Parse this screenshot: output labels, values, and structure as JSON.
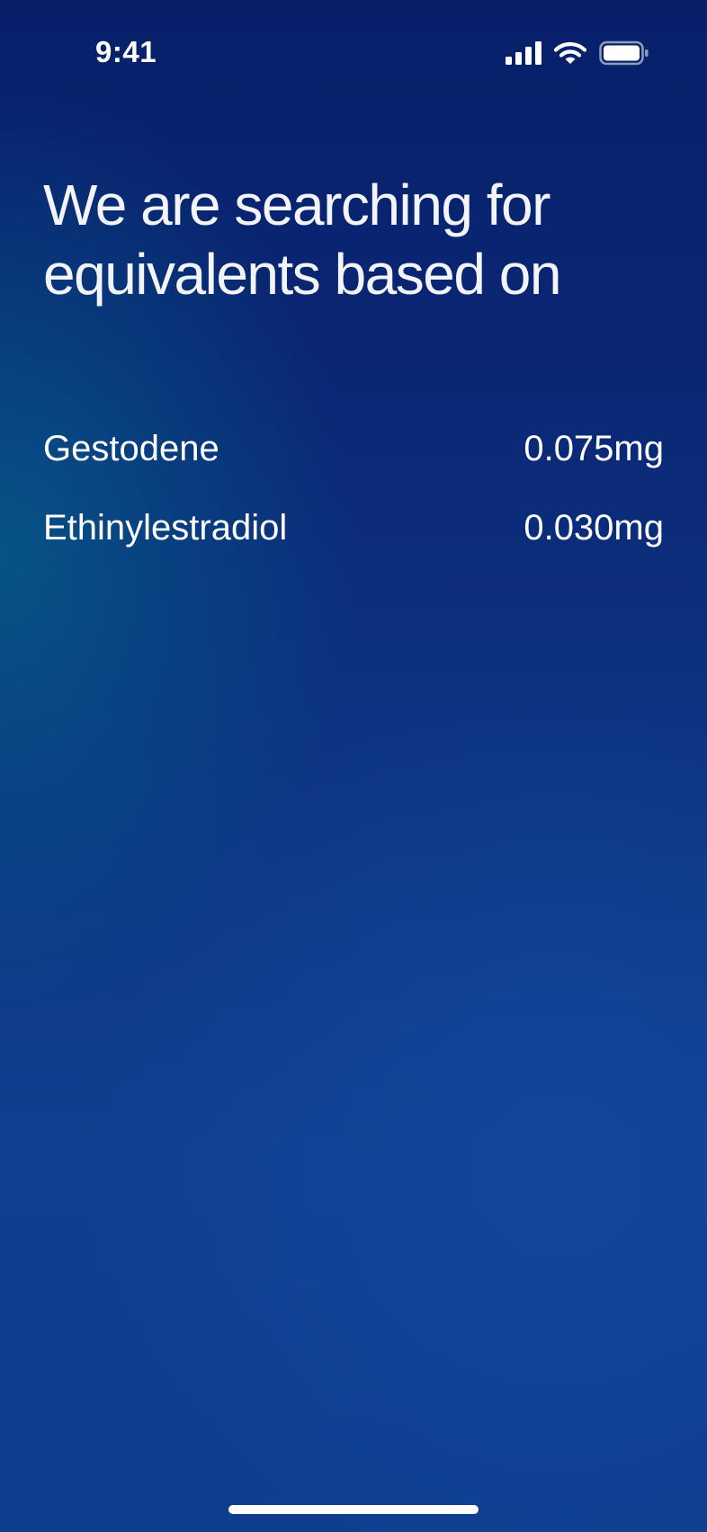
{
  "status_bar": {
    "time": "9:41",
    "icons": [
      "signal-icon",
      "wifi-icon",
      "battery-icon"
    ]
  },
  "screen": {
    "headline_line1": "We are searching for",
    "headline_line2": "equivalents based on"
  },
  "ingredients": [
    {
      "name": "Gestodene",
      "dose": "0.075mg"
    },
    {
      "name": "Ethinylestradiol",
      "dose": "0.030mg"
    }
  ],
  "colors": {
    "background_top": "#08206a",
    "background_teal": "#065688",
    "background_bottom": "#113f8f",
    "text": "#ffffff"
  }
}
